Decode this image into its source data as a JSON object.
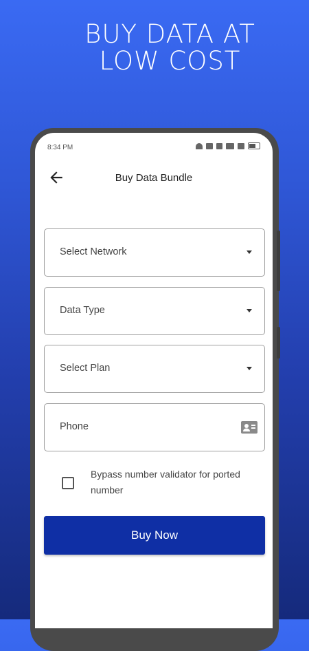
{
  "promo": {
    "line1": "BUY DATA AT",
    "line2": "LOW COST"
  },
  "status_bar": {
    "time": "8:34 PM"
  },
  "app_bar": {
    "title": "Buy Data Bundle",
    "back_icon": "arrow-back-icon"
  },
  "form": {
    "network_placeholder": "Select Network",
    "data_type_placeholder": "Data Type",
    "plan_placeholder": "Select Plan",
    "phone_placeholder": "Phone",
    "bypass_label": "Bypass number validator for ported number",
    "bypass_checked": false,
    "submit_label": "Buy Now"
  },
  "colors": {
    "accent": "#0f2fa5",
    "background_top": "#3a6af3",
    "background_bottom": "#152a7c"
  }
}
